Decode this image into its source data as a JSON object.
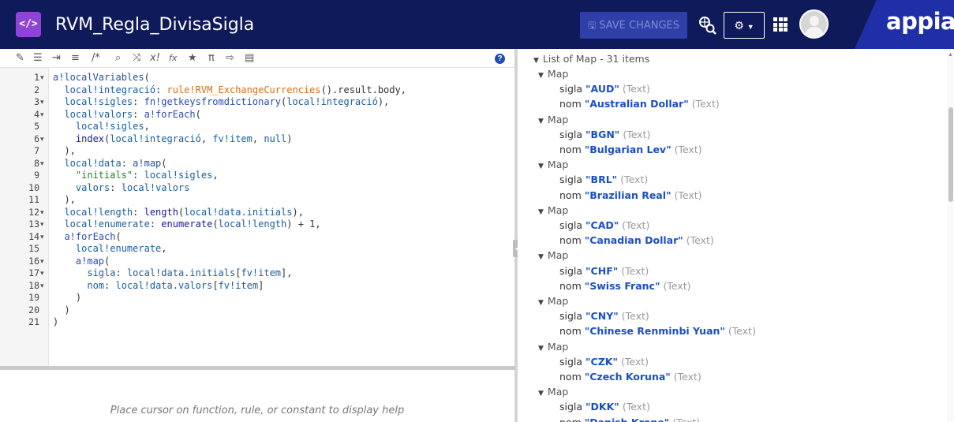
{
  "header": {
    "logo_glyph": "</>",
    "title": "RVM_Regla_DivisaSigla",
    "save_label": "SAVE CHANGES",
    "brand": "appian",
    "colors": {
      "header_bg": "#0f1a5a",
      "save_bg": "#2e40a8",
      "logo_bg": "#8e44d6"
    }
  },
  "toolbar": {
    "items": [
      "format-icon",
      "comment-block-icon",
      "indent-icon",
      "outdent-icon",
      "comment-label",
      "search-icon",
      "shuffle-icon",
      "error-check-icon",
      "function-icon",
      "favorite-icon",
      "pi-icon",
      "export-icon",
      "preview-icon"
    ],
    "comment_label": "/*",
    "error_label": "x!",
    "fx_label": "fx",
    "pi_label": "π",
    "help_label": "?"
  },
  "code": {
    "line_numbers": [
      "1",
      "2",
      "3",
      "4",
      "5",
      "6",
      "7",
      "8",
      "9",
      "10",
      "11",
      "12",
      "13",
      "14",
      "15",
      "16",
      "17",
      "18",
      "19",
      "20",
      "21"
    ],
    "lines": [
      "a!localVariables(",
      "  local!integració: rule!RVM_ExchangeCurrencies().result.body,",
      "  local!sigles: fn!getkeysfromdictionary(local!integració),",
      "  local!valors: a!forEach(",
      "    local!sigles,",
      "    index(local!integració, fv!item, null)",
      "  ),",
      "  local!data: a!map(",
      "    \"initials\": local!sigles,",
      "    valors: local!valors",
      "  ),",
      "  local!length: length(local!data.initials),",
      "  local!enumerate: enumerate(local!length) + 1,",
      "  a!forEach(",
      "    local!enumerate,",
      "    a!map(",
      "      sigla: local!data.initials[fv!item],",
      "      nom: local!data.valors[fv!item]",
      "    )",
      "  )",
      ")"
    ]
  },
  "help": {
    "text": "Place cursor on function, rule, or constant to display help"
  },
  "results": {
    "list_header": "List of Map - 31 items",
    "map_label": "Map",
    "key_sigla": "sigla",
    "key_nom": "nom",
    "type_label": "(Text)",
    "items": [
      {
        "sigla": "\"AUD\"",
        "nom": "\"Australian Dollar\""
      },
      {
        "sigla": "\"BGN\"",
        "nom": "\"Bulgarian Lev\""
      },
      {
        "sigla": "\"BRL\"",
        "nom": "\"Brazilian Real\""
      },
      {
        "sigla": "\"CAD\"",
        "nom": "\"Canadian Dollar\""
      },
      {
        "sigla": "\"CHF\"",
        "nom": "\"Swiss Franc\""
      },
      {
        "sigla": "\"CNY\"",
        "nom": "\"Chinese Renminbi Yuan\""
      },
      {
        "sigla": "\"CZK\"",
        "nom": "\"Czech Koruna\""
      },
      {
        "sigla": "\"DKK\"",
        "nom": "\"Danish Krone\""
      }
    ]
  }
}
